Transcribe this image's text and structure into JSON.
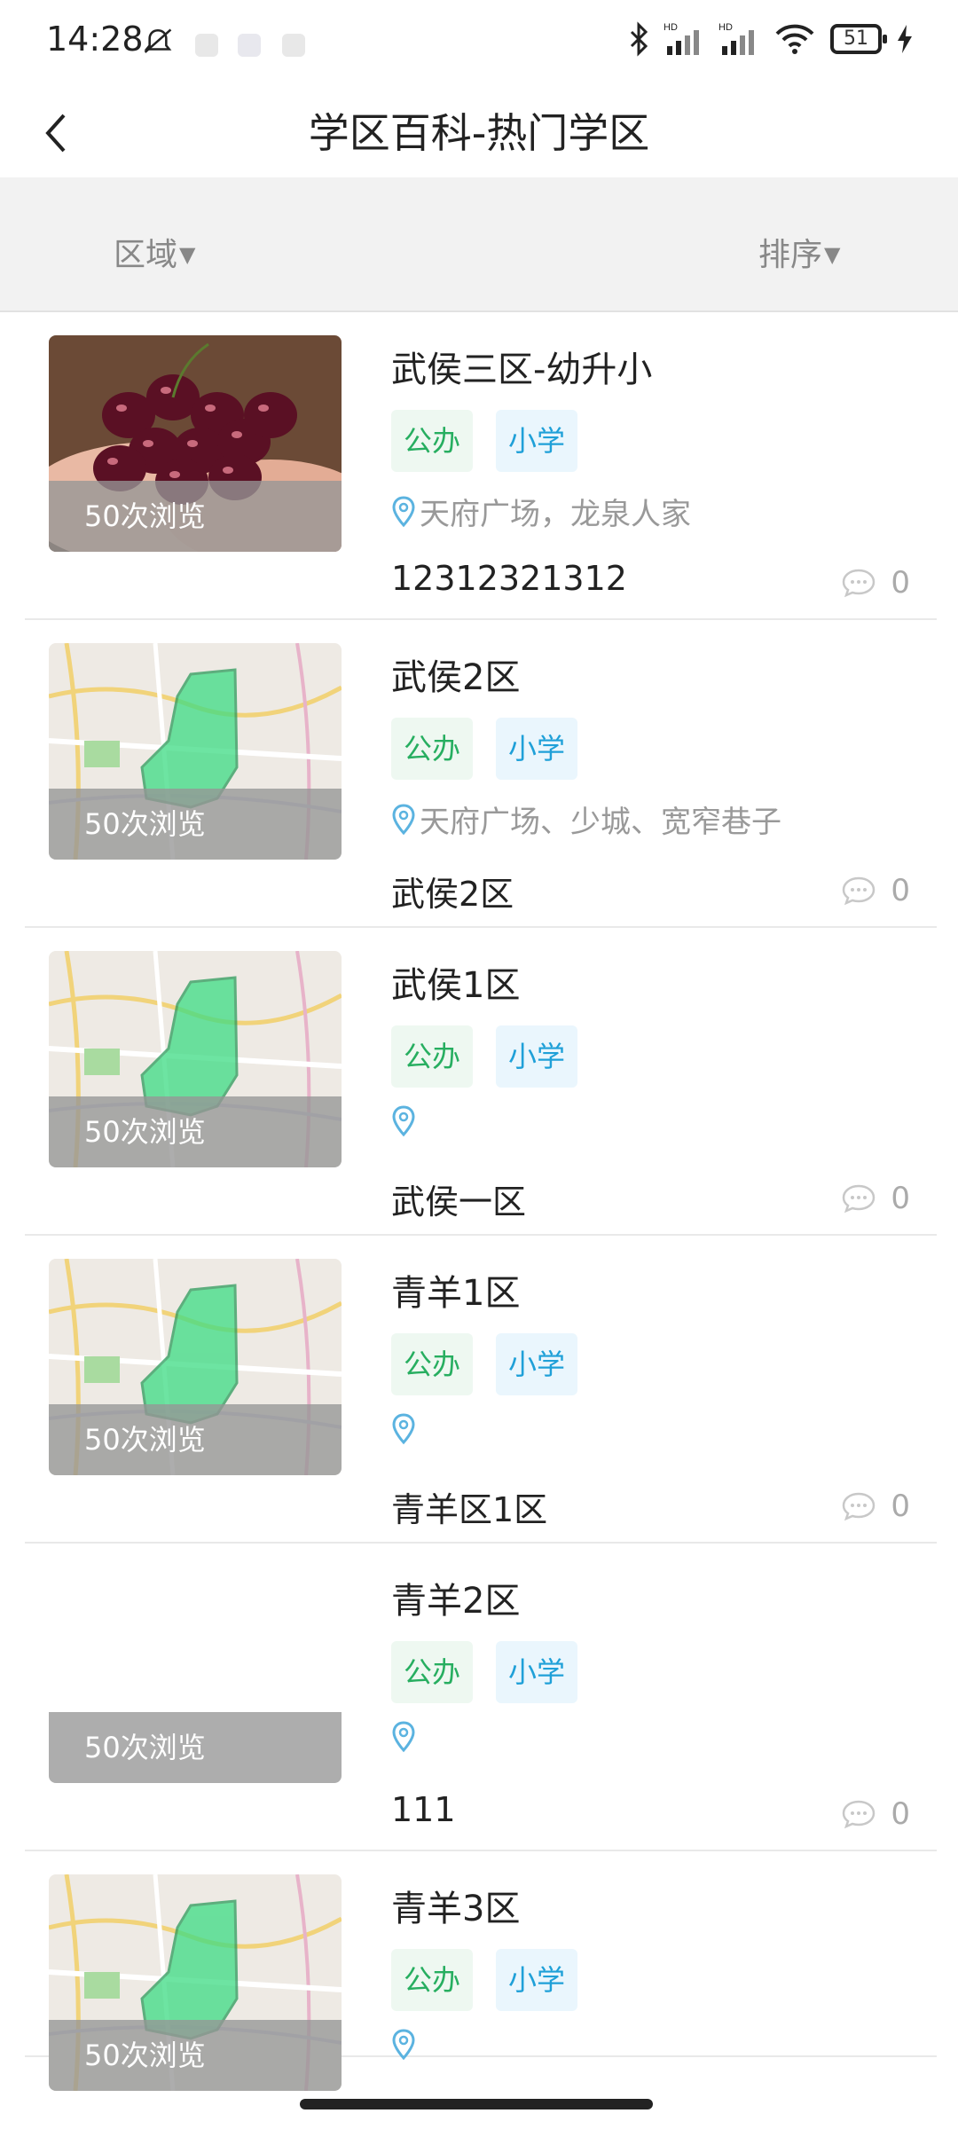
{
  "status_bar": {
    "time": "14:28",
    "battery": "51",
    "icons": [
      "mute-bell-icon",
      "app-notify-icon",
      "sync-icon",
      "mi-icon",
      "bluetooth-icon",
      "hd-signal-icon",
      "hd-signal-icon",
      "wifi-icon",
      "charging-icon"
    ]
  },
  "header": {
    "title": "学区百科-热门学区",
    "back_icon": "chevron-left-icon"
  },
  "filters": {
    "region": "区域",
    "sort": "排序",
    "arrow": "▼"
  },
  "items": [
    {
      "title": "武侯三区-幼升小",
      "tag1": "公办",
      "tag2": "小学",
      "location": "天府广场，龙泉人家",
      "desc": "12312321312",
      "comments": "0",
      "views": "50次浏览",
      "image": "cherries"
    },
    {
      "title": "武侯2区",
      "tag1": "公办",
      "tag2": "小学",
      "location": "天府广场、少城、宽窄巷子",
      "desc": "武侯2区",
      "comments": "0",
      "views": "50次浏览",
      "image": "map"
    },
    {
      "title": "武侯1区",
      "tag1": "公办",
      "tag2": "小学",
      "location": "",
      "desc": "武侯一区",
      "comments": "0",
      "views": "50次浏览",
      "image": "map"
    },
    {
      "title": "青羊1区",
      "tag1": "公办",
      "tag2": "小学",
      "location": "",
      "desc": "青羊区1区",
      "comments": "0",
      "views": "50次浏览",
      "image": "map"
    },
    {
      "title": "青羊2区",
      "tag1": "公办",
      "tag2": "小学",
      "location": "",
      "desc": "111",
      "comments": "0",
      "views": "50次浏览",
      "image": "none"
    },
    {
      "title": "青羊3区",
      "tag1": "公办",
      "tag2": "小学",
      "location": "",
      "desc": "",
      "comments": "",
      "views": "50次浏览",
      "image": "map"
    }
  ],
  "colors": {
    "tag_gov": "#27ae60",
    "tag_level": "#1fa0d8",
    "map_region": "#3ddc84"
  }
}
